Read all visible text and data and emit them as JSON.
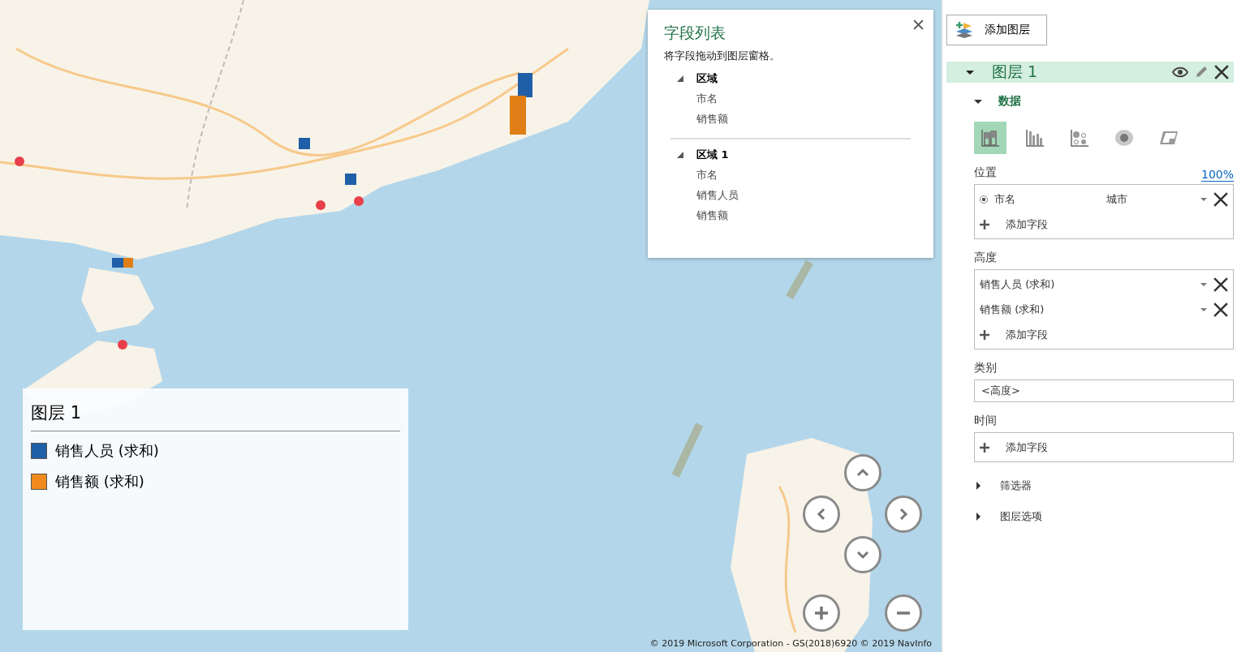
{
  "field_list": {
    "title": "字段列表",
    "hint": "将字段拖动到图层窗格。",
    "tables": [
      {
        "name": "区域",
        "expanded": true,
        "fields": [
          "市名",
          "销售额"
        ]
      },
      {
        "name": "区域 1",
        "expanded": true,
        "fields": [
          "市名",
          "销售人员",
          "销售额"
        ]
      }
    ]
  },
  "legend": {
    "title": "图层 1",
    "items": [
      {
        "label": "销售人员 (求和)",
        "color": "#1f5fa8"
      },
      {
        "label": "销售额 (求和)",
        "color": "#f08a1c"
      }
    ]
  },
  "attribution": "© 2019 Microsoft Corporation - GS(2018)6920  © 2019 NavInfo",
  "panel": {
    "add_layer": "添加图层",
    "layer": {
      "name": "图层 1",
      "expanded": true
    },
    "data_section": {
      "label": "数据",
      "expanded": true
    },
    "visual_types": [
      {
        "kind": "stacked",
        "selected": true
      },
      {
        "kind": "clustered",
        "selected": false
      },
      {
        "kind": "bubble",
        "selected": false
      },
      {
        "kind": "heatmap",
        "selected": false
      },
      {
        "kind": "region",
        "selected": false
      }
    ],
    "location": {
      "label": "位置",
      "zoom": "100%",
      "fields": [
        {
          "name": "市名",
          "type": "城市",
          "selected": true
        }
      ],
      "add": "添加字段"
    },
    "height": {
      "label": "高度",
      "fields": [
        {
          "name": "销售人员 (求和)"
        },
        {
          "name": "销售额 (求和)"
        }
      ],
      "add": "添加字段"
    },
    "category": {
      "label": "类别",
      "value": "<高度>"
    },
    "time": {
      "label": "时间",
      "add": "添加字段"
    },
    "sections": [
      {
        "label": "筛选器",
        "expanded": false
      },
      {
        "label": "图层选项",
        "expanded": false
      }
    ]
  }
}
